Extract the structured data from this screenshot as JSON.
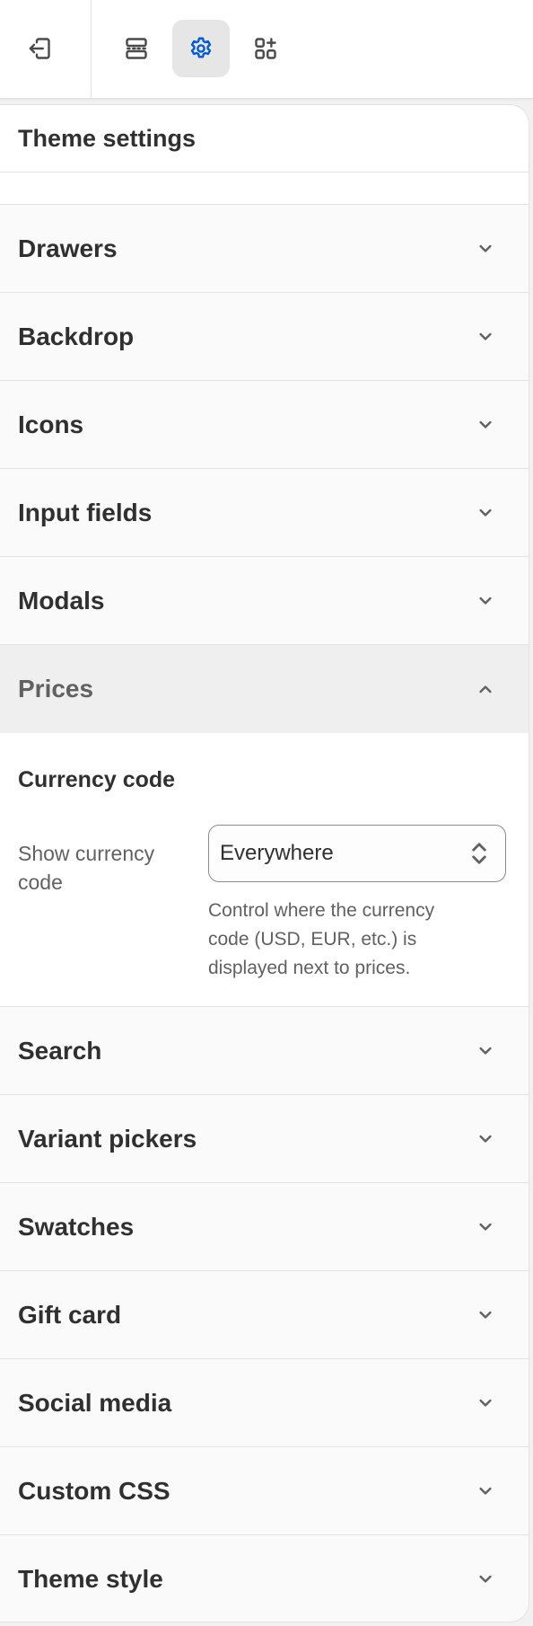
{
  "toolbar": {
    "buttons": [
      {
        "name": "exit",
        "icon": "exit-icon"
      },
      {
        "name": "sections",
        "icon": "sections-icon"
      },
      {
        "name": "theme-settings",
        "icon": "gear-icon",
        "active": true
      },
      {
        "name": "apps",
        "icon": "apps-icon"
      }
    ],
    "active_color": "#005bd3"
  },
  "panel": {
    "title": "Theme settings",
    "sections_before": [
      {
        "label": "Drawers"
      },
      {
        "label": "Backdrop"
      },
      {
        "label": "Icons"
      },
      {
        "label": "Input fields"
      },
      {
        "label": "Modals"
      }
    ],
    "expanded_section": {
      "label": "Prices",
      "subheading": "Currency code",
      "field_label": "Show currency code",
      "select_value": "Everywhere",
      "help_text": "Control where the currency code (USD, EUR, etc.) is displayed next to prices."
    },
    "sections_after": [
      {
        "label": "Search"
      },
      {
        "label": "Variant pickers"
      },
      {
        "label": "Swatches"
      },
      {
        "label": "Gift card"
      },
      {
        "label": "Social media"
      },
      {
        "label": "Custom CSS"
      },
      {
        "label": "Theme style"
      }
    ]
  }
}
